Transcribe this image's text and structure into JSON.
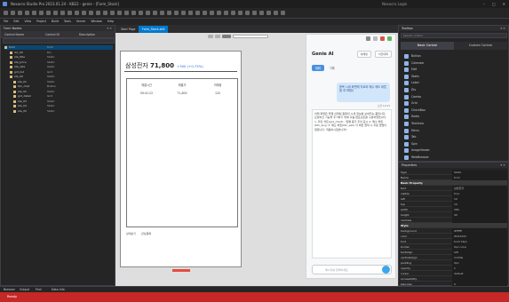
{
  "app": {
    "title": "Nexacro Studio Pro 2023.01.24 - KB22 - genie - [Form_Stock]",
    "right_title": "Nexacro Login",
    "status": "Ready",
    "bottom_tabs": [
      "Browser",
      "Output",
      "Find",
      "Data Info"
    ]
  },
  "menu": [
    "File",
    "Edit",
    "View",
    "Project",
    "Build",
    "Tools",
    "Server",
    "Window",
    "Help"
  ],
  "left_panel": {
    "title": "Form Nodes",
    "columns": [
      "Control Name",
      "Control ID",
      "Description"
    ],
    "rows": [
      {
        "name": "form",
        "type": "form"
      },
      {
        "name": "div_00",
        "type": "Div"
      },
      {
        "name": "sta_title",
        "type": "Static"
      },
      {
        "name": "sta_price",
        "type": "Static"
      },
      {
        "name": "sta_rate",
        "type": "Static"
      },
      {
        "name": "grd_list",
        "type": "Grid"
      },
      {
        "name": "sta_00",
        "type": "Static"
      },
      {
        "name": "sta_01",
        "type": "Static"
      },
      {
        "name": "btn_chat",
        "type": "Button"
      },
      {
        "name": "sta_02",
        "type": "Static"
      },
      {
        "name": "grd_detail",
        "type": "Grid"
      },
      {
        "name": "sta_03",
        "type": "Static"
      },
      {
        "name": "sta_04",
        "type": "Static"
      },
      {
        "name": "sta_05",
        "type": "Static"
      }
    ]
  },
  "design": {
    "tabs": [
      "Start Page",
      "Form_Stock.xfdl"
    ],
    "stock_name": "삼성전자",
    "price": "71,800",
    "change": "+300 (+0.75%)",
    "table_headers": [
      "체결시간",
      "체결가",
      "거래량"
    ],
    "table_row": [
      "09:41:22",
      "71,800",
      "120"
    ],
    "footer": [
      "상세보기",
      "관심종목"
    ]
  },
  "genie": {
    "title": "Genie AI",
    "buttons": [
      "새채팅",
      "이전대화"
    ],
    "tabs": [
      "대화",
      "기록"
    ],
    "user_msg": "종목 시세 화면에 차트와 매수 매도 버튼을 추가해줘",
    "time": "오전 10:15",
    "response": "아래 화면은 현재 선택된 종목의 시세 정보를 보여주는 폼입니다. 요청하신 기능을 추가하기 위해 다음 컴포넌트를 구성하였습니다. 1. 라인 차트(grd_chart) - 일별 종가 추이 표시 2. 매수 버튼(btn_buy) 3. 매도 버튼(btn_sell) 각 버튼 클릭 시 주문 팝업이 열립니다. 적용하시겠습니까?",
    "placeholder": "메시지를 입력하세요"
  },
  "toolbox": {
    "title": "Toolbox",
    "search": "Search control",
    "tabs": [
      "Basic Control",
      "Custom Control"
    ],
    "items": [
      "Button",
      "Calendar",
      "Edit",
      "Static",
      "Label",
      "Div",
      "Combo",
      "Grid",
      "CheckBox",
      "Radio",
      "TextArea",
      "Menu",
      "Tab",
      "Spin",
      "ImageViewer",
      "WebBrowser"
    ]
  },
  "properties": {
    "title": "Properties",
    "rows": [
      {
        "k": "Type",
        "v": "Static"
      },
      {
        "k": "Name",
        "v": "form"
      },
      {
        "k": "Basic Property",
        "v": "",
        "cat": true
      },
      {
        "k": "text",
        "v": "삼성전자"
      },
      {
        "k": "visible",
        "v": "true"
      },
      {
        "k": "left",
        "v": "10"
      },
      {
        "k": "top",
        "v": "10"
      },
      {
        "k": "width",
        "v": "280"
      },
      {
        "k": "height",
        "v": "40"
      },
      {
        "k": "cssclass",
        "v": ""
      },
      {
        "k": "Style",
        "v": "",
        "cat": true
      },
      {
        "k": "background",
        "v": "#ffffff"
      },
      {
        "k": "color",
        "v": "#222222"
      },
      {
        "k": "font",
        "v": "bold 14px"
      },
      {
        "k": "border",
        "v": "0px none"
      },
      {
        "k": "textAlign",
        "v": "left"
      },
      {
        "k": "verticalAlign",
        "v": "middle"
      },
      {
        "k": "padding",
        "v": "0px"
      },
      {
        "k": "opacity",
        "v": "1"
      },
      {
        "k": "cursor",
        "v": "default"
      },
      {
        "k": "accessibility",
        "v": ""
      },
      {
        "k": "taborder",
        "v": "0"
      }
    ]
  }
}
